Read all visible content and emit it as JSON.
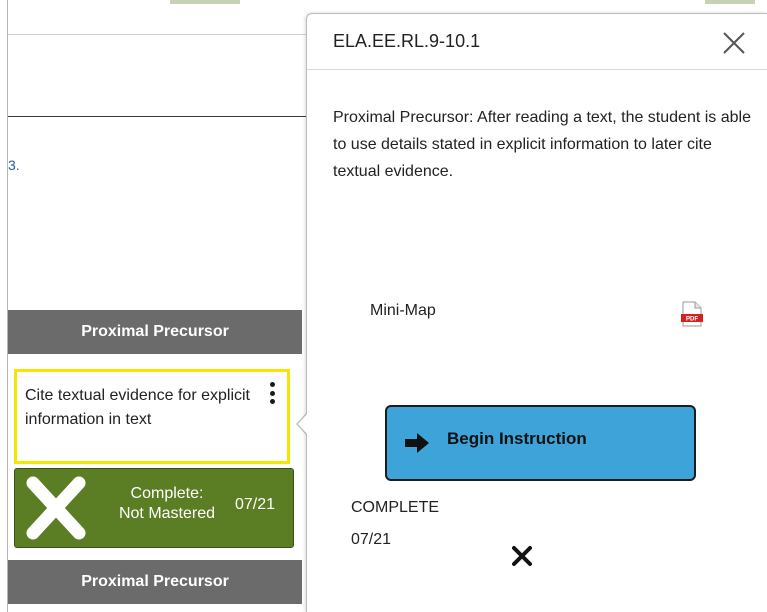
{
  "left_panel": {
    "stray_mark": "3.",
    "column_header_1": "Proximal Precursor",
    "column_header_2": "Proximal Precursor",
    "card": {
      "text": "Cite textual evidence for explicit information in text"
    },
    "status": {
      "label_line1": "Complete:",
      "label_line2": "Not Mastered",
      "date": "07/21",
      "icon": "x-icon",
      "color": "#5b7d23"
    }
  },
  "popover": {
    "title": "ELA.EE.RL.9-10.1",
    "close_icon": "close-icon",
    "description": "Proximal Precursor: After reading a text, the student is able to use details stated in explicit information to later cite textual evidence.",
    "minimap_label": "Mini-Map",
    "pdf_icon": "pdf-icon",
    "begin_button_label": "Begin Instruction",
    "begin_button_color": "#3ea3d8",
    "complete_label": "COMPLETE",
    "complete_date": "07/21",
    "status_icon": "x-icon"
  },
  "colors": {
    "header_gray": "#6b6b6b",
    "card_border": "#f3e600"
  }
}
